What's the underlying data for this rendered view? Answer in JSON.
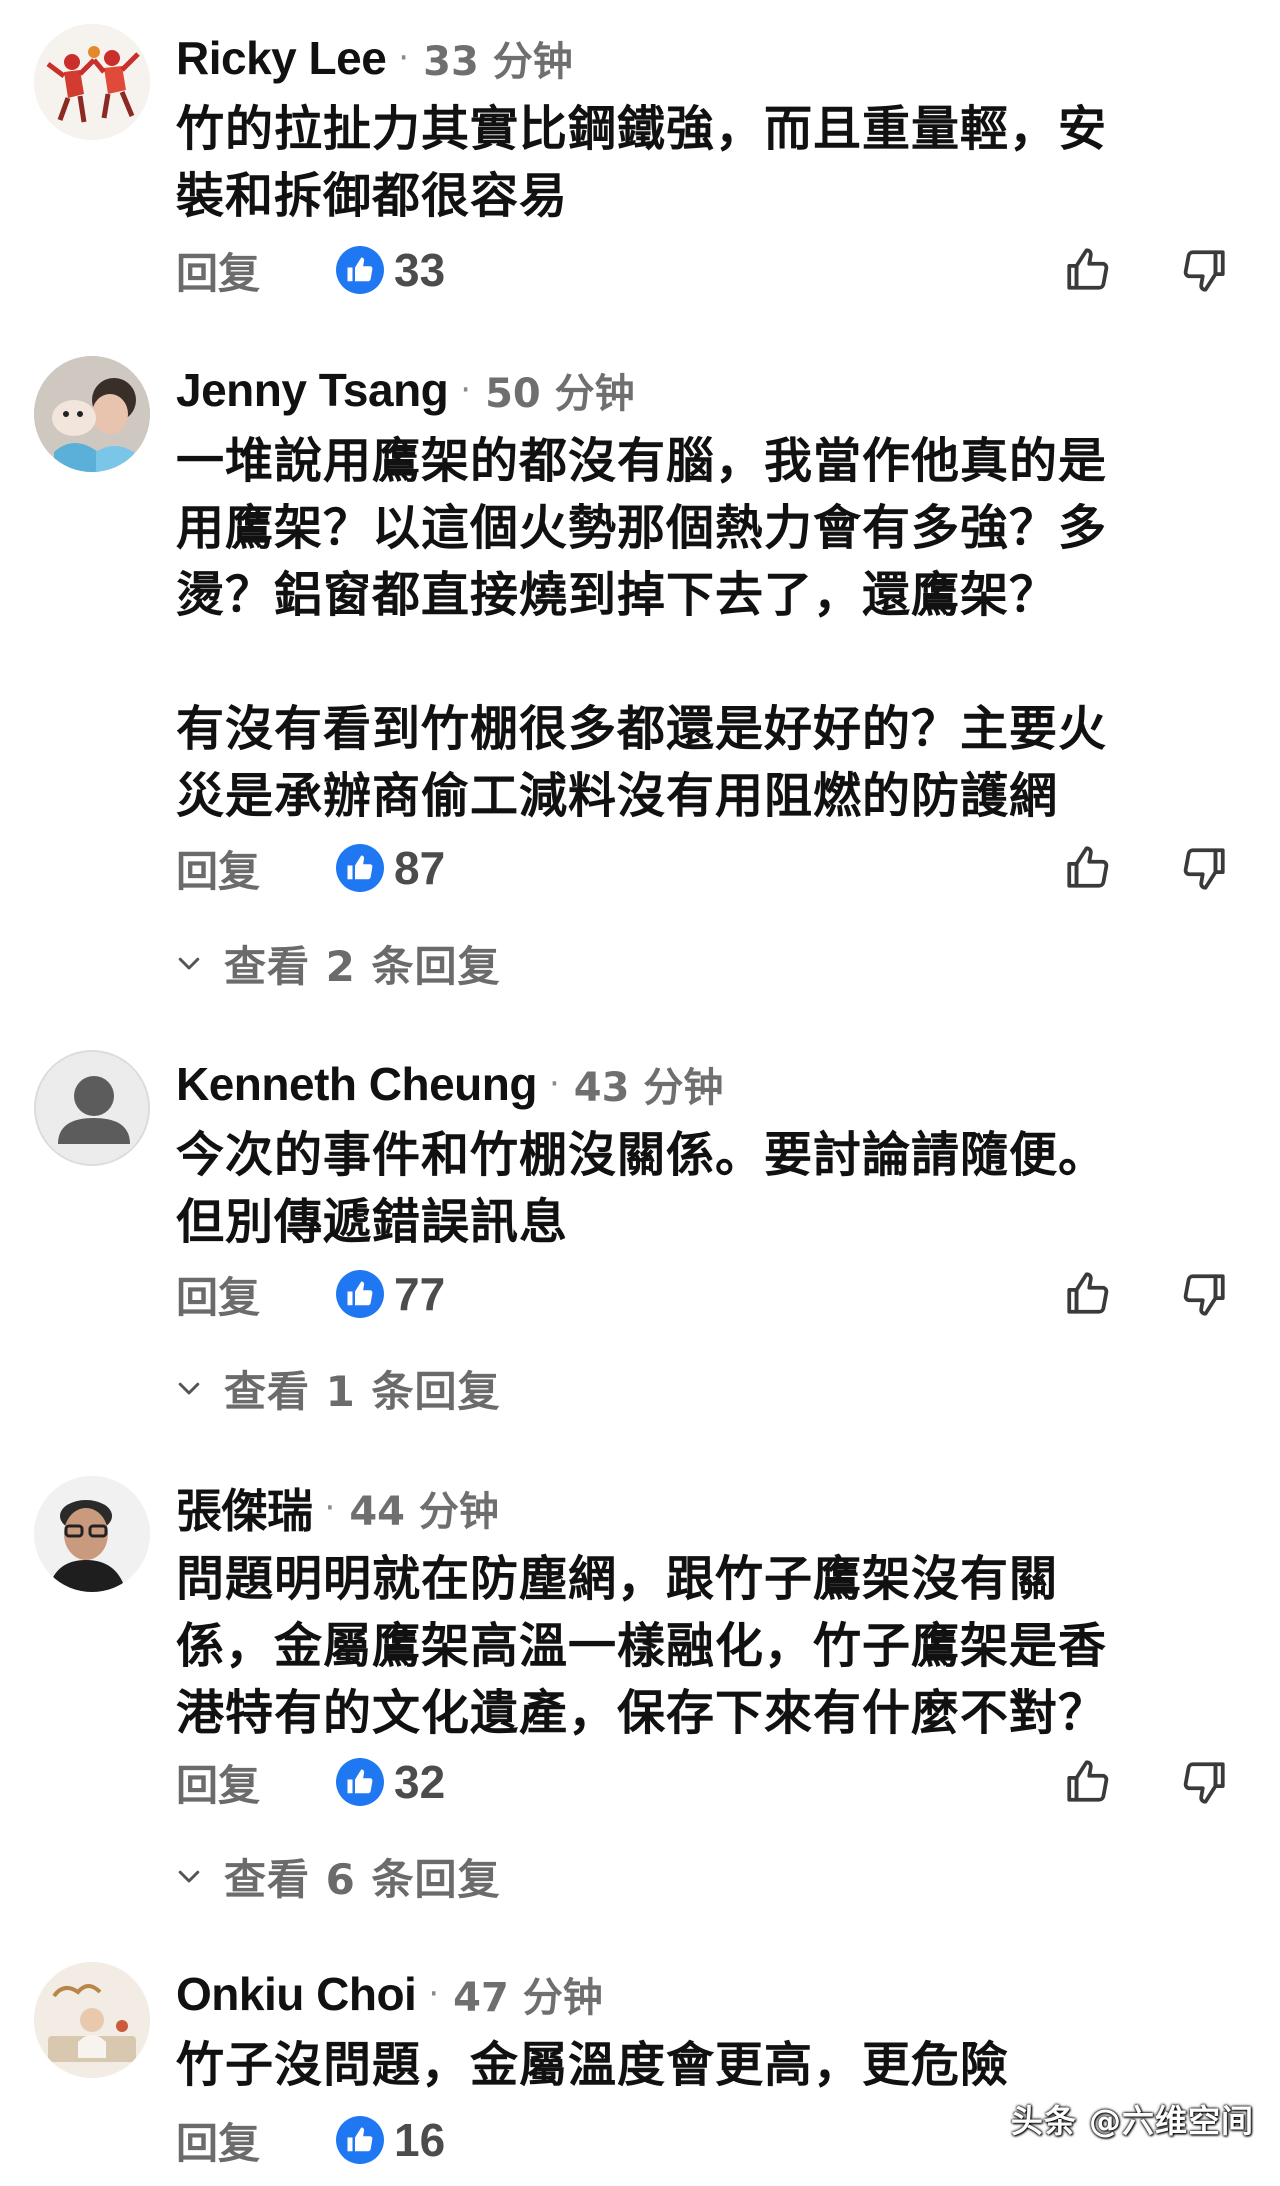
{
  "comments": [
    {
      "author": "Ricky Lee",
      "time": "33 分钟",
      "lines": [
        "竹的拉扯力其實比鋼鐵強，而且重量輕，安",
        "裝和拆御都很容易"
      ],
      "reply_label": "回复",
      "likes": "33"
    },
    {
      "author": "Jenny Tsang",
      "time": "50 分钟",
      "lines": [
        "一堆說用鷹架的都沒有腦，我當作他真的是",
        "用鷹架？以這個火勢那個熱力會有多強？多",
        "燙？鋁窗都直接燒到掉下去了，還鷹架？"
      ],
      "lines2": [
        "有沒有看到竹棚很多都還是好好的？主要火",
        "災是承辦商偷工減料沒有用阻燃的防護網"
      ],
      "reply_label": "回复",
      "likes": "87",
      "view_replies": "查看 2 条回复"
    },
    {
      "author": "Kenneth Cheung",
      "time": "43 分钟",
      "lines": [
        "今次的事件和竹棚沒關係。要討論請隨便。",
        "但別傳遞錯誤訊息"
      ],
      "reply_label": "回复",
      "likes": "77",
      "view_replies": "查看 1 条回复"
    },
    {
      "author": "張傑瑞",
      "time": "44 分钟",
      "lines": [
        "問題明明就在防塵網，跟竹子鷹架沒有關",
        "係，金屬鷹架高溫一樣融化，竹子鷹架是香",
        "港特有的文化遺產，保存下來有什麼不對？"
      ],
      "reply_label": "回复",
      "likes": "32",
      "view_replies": "查看 6 条回复"
    },
    {
      "author": "Onkiu Choi",
      "time": "47 分钟",
      "lines": [
        "竹子沒問題，金屬溫度會更高，更危險"
      ],
      "reply_label": "回复",
      "likes": "16"
    }
  ],
  "separator": "·",
  "watermark": "头条 @六维空间",
  "colors": {
    "like_badge": "#1f78f2",
    "muted_text": "#6b6b6b",
    "body_text": "#111111"
  },
  "icons": [
    "like-badge-icon",
    "thumbs-up-icon",
    "thumbs-down-icon",
    "chevron-down-icon",
    "avatar-default-icon"
  ]
}
